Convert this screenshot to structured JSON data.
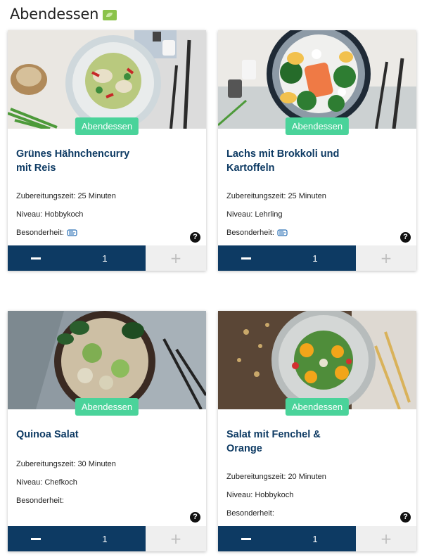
{
  "section": {
    "title": "Abendessen"
  },
  "labels": {
    "prep_prefix": "Zubereitungszeit: ",
    "level_prefix": "Niveau: ",
    "special_prefix": "Besonderheit:"
  },
  "colors": {
    "title": "#0d3a63",
    "badge": "#4ad39a",
    "stepper_active": "#0d3a63",
    "stepper_disabled": "#efefef"
  },
  "cards": [
    {
      "category": "Abendessen",
      "title_line1": "Grünes Hähnchencurry",
      "title_line2": "mit Reis",
      "prep_time": "25 Minuten",
      "level": "Hobbykoch",
      "special_icon": "lactose-free-icon",
      "help": "?",
      "quantity": "1",
      "minus_label": "−",
      "plus_label": "+"
    },
    {
      "category": "Abendessen",
      "title_line1": "Lachs mit Brokkoli und",
      "title_line2": "Kartoffeln",
      "prep_time": "25 Minuten",
      "level": "Lehrling",
      "special_icon": "lactose-free-icon",
      "help": "?",
      "quantity": "1",
      "minus_label": "−",
      "plus_label": "+"
    },
    {
      "category": "Abendessen",
      "title_line1": "Quinoa Salat",
      "title_line2": "",
      "prep_time": "30 Minuten",
      "level": "Chefkoch",
      "special_icon": "",
      "help": "?",
      "quantity": "1",
      "minus_label": "−",
      "plus_label": "+"
    },
    {
      "category": "Abendessen",
      "title_line1": "Salat mit Fenchel &",
      "title_line2": "Orange",
      "prep_time": "20 Minuten",
      "level": "Hobbykoch",
      "special_icon": "",
      "help": "?",
      "quantity": "1",
      "minus_label": "−",
      "plus_label": "+"
    }
  ]
}
